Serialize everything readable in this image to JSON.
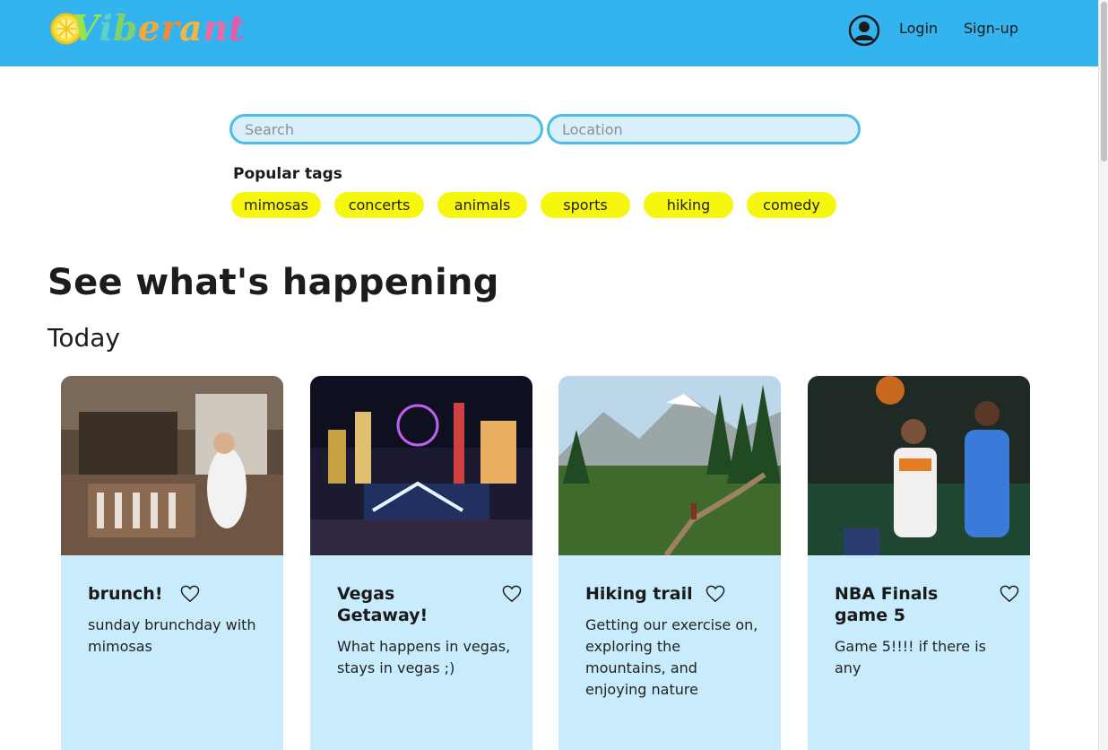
{
  "header": {
    "logo_text": "Viberant",
    "login_label": "Login",
    "signup_label": "Sign-up"
  },
  "search": {
    "search_placeholder": "Search",
    "location_placeholder": "Location"
  },
  "popular_tags": {
    "title": "Popular tags",
    "tags": [
      "mimosas",
      "concerts",
      "animals",
      "sports",
      "hiking",
      "comedy"
    ]
  },
  "main": {
    "page_title": "See what's happening",
    "section_title": "Today"
  },
  "cards": [
    {
      "title": "brunch!",
      "description": "sunday brunchday with mimosas"
    },
    {
      "title": "Vegas Getaway!",
      "description": "What happens in vegas, stays in vegas ;)"
    },
    {
      "title": "Hiking trail",
      "description": "Getting our exercise on, exploring the mountains, and enjoying nature"
    },
    {
      "title": "NBA Finals game 5",
      "description": "Game 5!!!! if there is any"
    }
  ],
  "colors": {
    "header_bg": "#34b4ef",
    "tag_bg": "#f6f60e",
    "card_bg": "#c8ecfc",
    "input_bg": "#d9f0fa"
  },
  "icons": {
    "user": "user-circle-icon",
    "favorite": "heart-outline-icon"
  }
}
